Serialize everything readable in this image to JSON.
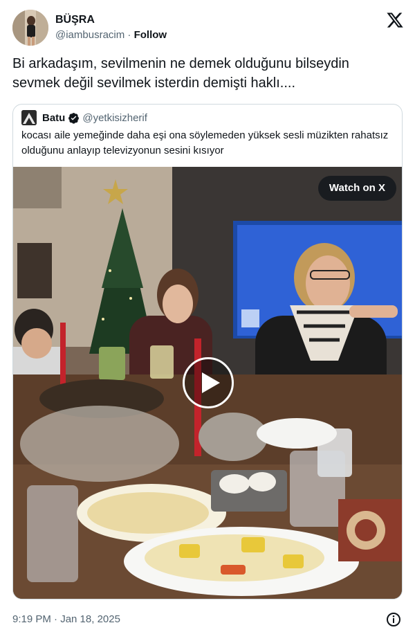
{
  "author": {
    "name": "BÜŞRA",
    "handle": "@iambusracim",
    "separator": " · ",
    "follow_label": "Follow"
  },
  "tweet": {
    "text": "Bi arkadaşım, sevilmenin ne demek olduğunu bilseydin sevmek değil sevilmek isterdin demişti haklı...."
  },
  "quoted": {
    "name": "Batu",
    "handle": "@yetkisizherif",
    "verified": true,
    "text": "kocası aile yemeğinde daha eşi ona söylemeden yüksek sesli müzikten rahatsız olduğunu anlayıp televizyonun sesini kısıyor",
    "media": {
      "type": "video",
      "watch_label": "Watch on X"
    }
  },
  "footer": {
    "timestamp": "9:19 PM · Jan 18, 2025"
  },
  "icons": {
    "brand": "x-logo-icon",
    "verified": "verified-badge-icon",
    "play": "play-icon",
    "info": "info-icon"
  },
  "colors": {
    "text": "#0f1419",
    "secondary": "#536471",
    "border": "#cfd9de",
    "verified_badge": "#0f1419"
  }
}
